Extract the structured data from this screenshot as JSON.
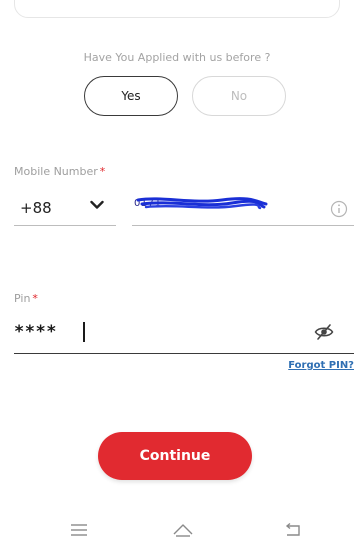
{
  "applied_question": {
    "text": "Have You Applied with us before ?",
    "options": [
      {
        "label": "Yes",
        "selected": true
      },
      {
        "label": "No",
        "selected": false
      }
    ]
  },
  "mobile": {
    "label": "Mobile Number",
    "required_mark": "*",
    "country_code": "+88",
    "value": "0171",
    "value_redacted": true,
    "icons": {
      "dropdown": "chevron-down-icon",
      "info": "info-icon"
    }
  },
  "pin": {
    "label": "Pin",
    "required_mark": "*",
    "value": "****",
    "icon": "eye-slash-icon",
    "forgot_link": "Forgot PIN?"
  },
  "continue_label": "Continue",
  "colors": {
    "accent": "#e12a30",
    "link": "#2f6fb3",
    "redaction": "#1a2fd6"
  },
  "navbar": {
    "icons": [
      "menu-icon",
      "home-icon",
      "back-icon"
    ]
  }
}
